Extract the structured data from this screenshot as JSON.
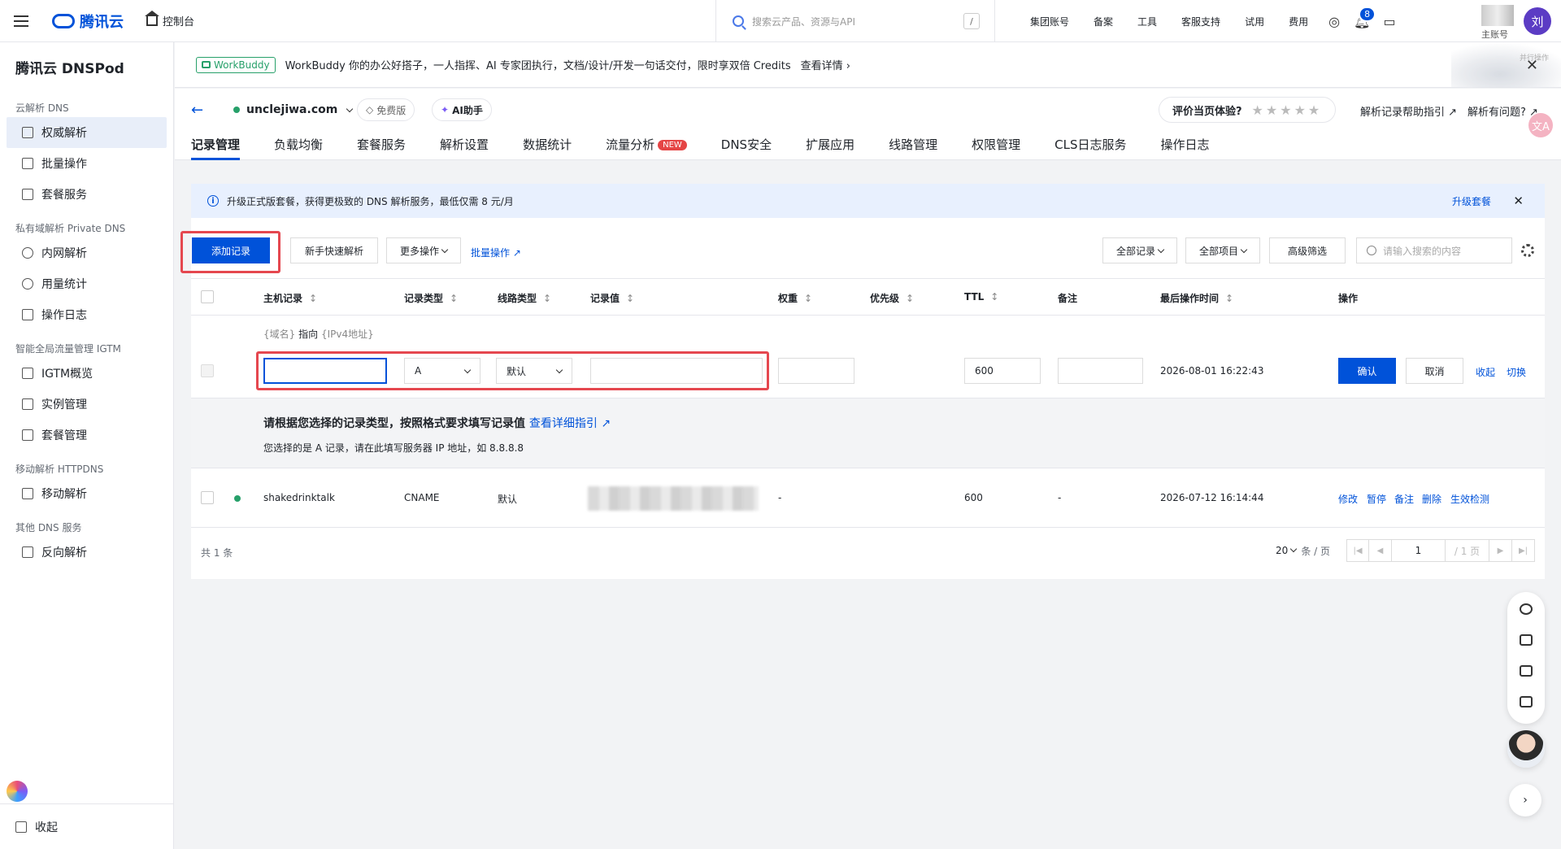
{
  "topbar": {
    "brand": "腾讯云",
    "console": "控制台",
    "search_placeholder": "搜索云产品、资源与API",
    "search_shortcut": "/",
    "nav": [
      "集团账号",
      "备案",
      "工具",
      "客服支持",
      "试用",
      "费用"
    ],
    "notification_count": "8",
    "sub_account": "主账号",
    "avatar_initial": "刘"
  },
  "sidebar": {
    "title": "腾讯云 DNSPod",
    "groups": [
      {
        "label": "云解析 DNS",
        "items": [
          {
            "label": "权威解析",
            "icon": "domain-icon",
            "active": true
          },
          {
            "label": "批量操作",
            "icon": "copy-icon"
          },
          {
            "label": "套餐服务",
            "icon": "package-icon"
          }
        ]
      },
      {
        "label": "私有域解析 Private DNS",
        "items": [
          {
            "label": "内网解析",
            "icon": "globe-icon"
          },
          {
            "label": "用量统计",
            "icon": "chart-icon"
          },
          {
            "label": "操作日志",
            "icon": "log-icon"
          }
        ]
      },
      {
        "label": "智能全局流量管理 IGTM",
        "items": [
          {
            "label": "IGTM概览",
            "icon": "grid-icon"
          },
          {
            "label": "实例管理",
            "icon": "instance-icon"
          },
          {
            "label": "套餐管理",
            "icon": "list-icon"
          }
        ]
      },
      {
        "label": "移动解析 HTTPDNS",
        "items": [
          {
            "label": "移动解析",
            "icon": "mobile-icon"
          }
        ]
      },
      {
        "label": "其他 DNS 服务",
        "items": [
          {
            "label": "反向解析",
            "icon": "reverse-icon"
          }
        ]
      }
    ],
    "collapse": "收起"
  },
  "banner": {
    "tag": "WorkBuddy",
    "text": "WorkBuddy 你的办公好搭子，一人指挥、AI 专家团执行，文档/设计/开发一句话交付，限时享双倍 Credits",
    "more": "查看详情",
    "side_text": "并行操作"
  },
  "header": {
    "domain": "unclejiwa.com",
    "plan": "免费版",
    "ai": "AI助手",
    "rating_label": "评价当页体验?",
    "stars": "★★★★★",
    "help1": "解析记录帮助指引",
    "help2": "解析有问题?",
    "tabs": [
      {
        "label": "记录管理",
        "active": true
      },
      {
        "label": "负载均衡"
      },
      {
        "label": "套餐服务"
      },
      {
        "label": "解析设置"
      },
      {
        "label": "数据统计"
      },
      {
        "label": "流量分析",
        "badge": "NEW"
      },
      {
        "label": "DNS安全"
      },
      {
        "label": "扩展应用"
      },
      {
        "label": "线路管理"
      },
      {
        "label": "权限管理"
      },
      {
        "label": "CLS日志服务"
      },
      {
        "label": "操作日志"
      }
    ]
  },
  "notice": {
    "text": "升级正式版套餐，获得更极致的 DNS 解析服务，最低仅需 8 元/月",
    "action": "升级套餐"
  },
  "toolbar": {
    "add": "添加记录",
    "quick": "新手快速解析",
    "more": "更多操作",
    "batch": "批量操作",
    "filter_records": "全部记录",
    "filter_items": "全部项目",
    "advanced": "高级筛选",
    "search_placeholder": "请输入搜索的内容"
  },
  "table": {
    "columns": [
      "主机记录",
      "记录类型",
      "线路类型",
      "记录值",
      "权重",
      "优先级",
      "TTL",
      "备注",
      "最后操作时间",
      "操作"
    ],
    "edit_row": {
      "hint_domain": "{域名}",
      "hint_points": "指向",
      "hint_value": "{IPv4地址}",
      "host": "",
      "type": "A",
      "line": "默认",
      "value": "",
      "weight": "",
      "ttl": "600",
      "remark": "",
      "time": "2026-08-01 16:22:43",
      "confirm": "确认",
      "cancel": "取消",
      "collapse": "收起",
      "switch": "切换"
    },
    "guide": {
      "title": "请根据您选择的记录类型，按照格式要求填写记录值",
      "link": "查看详细指引",
      "detail": "您选择的是 A 记录，请在此填写服务器 IP 地址，如 8.8.8.8"
    },
    "rows": [
      {
        "host": "shakedrinktalk",
        "type": "CNAME",
        "line": "默认",
        "weight": "-",
        "ttl": "600",
        "remark": "-",
        "time": "2026-07-12 16:14:44",
        "actions": [
          "修改",
          "暂停",
          "备注",
          "删除",
          "生效检测"
        ]
      }
    ],
    "total": "共 1 条",
    "page_size": "20",
    "page_size_unit": "条 / 页",
    "page": "1",
    "page_total": "/ 1 页"
  }
}
